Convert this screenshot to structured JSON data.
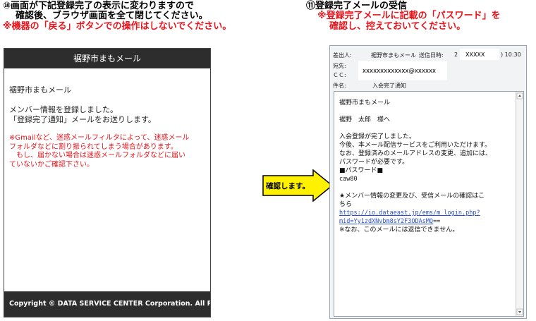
{
  "step10": {
    "title_line1": "⑩画面が下記登録完了の表示に変わりますので",
    "title_line2": "確認後、ブラウザ画面を全て閉じてください。",
    "warning": "※機器の「戻る」ボタンでの操作はしないでください。"
  },
  "step11": {
    "title": "⑪登録完了メールの受信",
    "note_line1": "※登録完了メールに記載の「パスワード」を",
    "note_line2": "確認し、控えておいてください。"
  },
  "phone": {
    "header": "裾野市まもメール",
    "site_name": "裾野市まもメール",
    "msg1": "メンバー情報を登録しました。",
    "msg2": "「登録完了通知」メールをお送りします。",
    "red1": "※Gmailなど、迷惑メールフィルタによって、迷惑メール",
    "red2": "フォルダなどに割り振られてしまう場合があります。",
    "red3": "　もし、届かない場合は迷惑メールフォルダなどに届い",
    "red4": "ていないかご確認下さい。",
    "footer": "Copyright © DATA SERVICE CENTER Corporation. All Ri..."
  },
  "arrow": {
    "label": "確認します。"
  },
  "mail": {
    "from_label": "差出人:",
    "from_value": "裾野市まもメール",
    "sent_label": "送信日時:",
    "sent_prefix": "2",
    "sent_mask": "XXXXX",
    "sent_time": ") 10:30",
    "to_label": "宛先:",
    "to_value": "xxxxxxxxxxxxx@xxxxxx",
    "cc_label": "ＣＣ:",
    "subject_label": "件名:",
    "subject_value": "入会完了通知",
    "body": {
      "l1": "裾野市まもメール",
      "l2": "裾野　太郎　様へ",
      "l3": "入会登録が完了しました。",
      "l4": "今後、本メール配信サービスをご利用いただけます。",
      "l5": "なお、登録済みのメールアドレスの変更、追加には、",
      "l6": "パスワードが必要です。",
      "l7": "■パスワード■",
      "l8": "caw80",
      "l9": "★メンバー情報の変更及び、受信メールの確認はこ",
      "l10": "ちら",
      "link1": "https://io.dataeast.jp/ems/m_login.php?",
      "link2": "mid=Yy1zdXNvbm8sY2F3ODAsMQ",
      "link2_tail": "==",
      "l11": "※なお、このメールには返信できません。"
    }
  },
  "colors": {
    "red": "#e8141b",
    "arrow_yellow": "#fff100",
    "dark_bar": "#2d2d2d",
    "link": "#2a4fd0"
  }
}
